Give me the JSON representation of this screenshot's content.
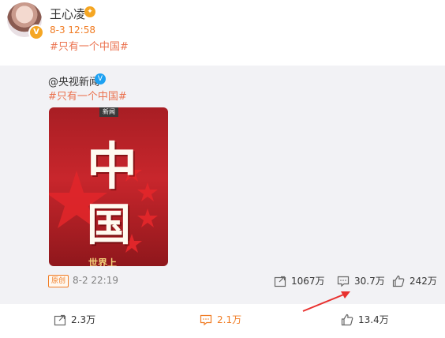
{
  "post": {
    "author": "王心凌",
    "time": "8-3 12:58",
    "hashtag": "#只有一个中国#",
    "badge_symbol": "V",
    "vip_symbol": "✦",
    "icons": [
      "avatar",
      "verified-badge-icon",
      "vip-icon"
    ]
  },
  "repost": {
    "author": "@央视新闻",
    "verified_symbol": "V",
    "hashtag": "#只有一个中国#",
    "poster": {
      "tag": "新闻",
      "char1": "中",
      "char2": "国",
      "bottom_text": "世界上"
    },
    "original_label": "原创",
    "time": "8-2 22:19",
    "stats": {
      "repost": "1067万",
      "comment": "30.7万",
      "like": "242万"
    }
  },
  "footer": {
    "repost": "2.3万",
    "comment": "2.1万",
    "like": "13.4万"
  },
  "colors": {
    "accent_orange": "#f07c24",
    "hashtag": "#eb7350",
    "repost_bg": "#f2f2f5",
    "arrow": "#e8312f"
  }
}
